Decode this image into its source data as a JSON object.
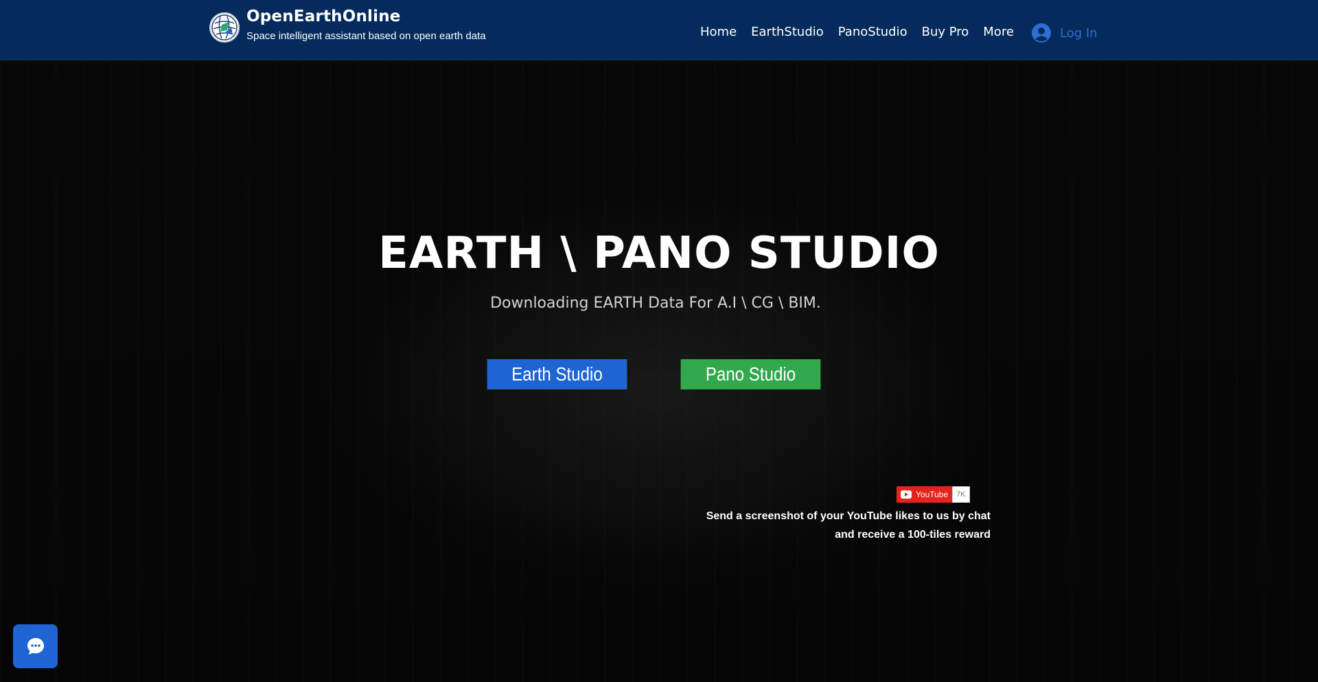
{
  "header": {
    "brand_title": "OpenEarthOnline",
    "brand_subtitle": "Space intelligent assistant based on open earth data",
    "nav": [
      "Home",
      "EarthStudio",
      "PanoStudio",
      "Buy Pro",
      "More"
    ],
    "login_label": "Log In"
  },
  "hero": {
    "title": "EARTH \\ PANO STUDIO",
    "subtitle": "Downloading EARTH Data For A.I \\ CG \\ BIM.",
    "earth_button": "Earth Studio",
    "pano_button": "Pano Studio"
  },
  "youtube": {
    "label": "YouTube",
    "count": "7K"
  },
  "promo": {
    "line1": "Send a screenshot of your YouTube likes to us by chat",
    "line2": "and receive a 100-tiles reward"
  },
  "colors": {
    "header_bg": "#052b5c",
    "earth_button": "#1e65d3",
    "pano_button": "#31a84b",
    "login_accent": "#2d6fd2",
    "youtube_red": "#e3231c"
  },
  "icons": [
    "globe-logo-icon",
    "user-avatar-icon",
    "youtube-play-icon",
    "chat-bubble-icon"
  ]
}
